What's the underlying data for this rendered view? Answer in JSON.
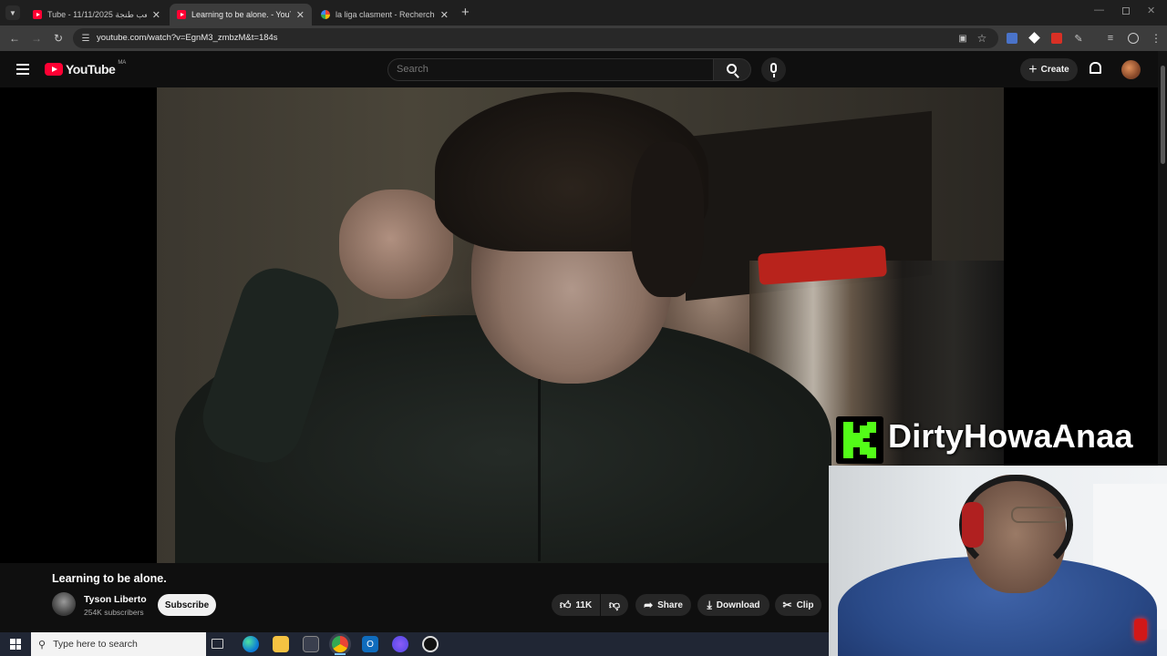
{
  "browser": {
    "tabs": [
      {
        "title": "Tube - 11/11/2025 ملعب طنجة",
        "active": false
      },
      {
        "title": "Learning to be alone. - YouTub",
        "active": true
      },
      {
        "title": "la liga clasment - Recherche Go",
        "active": false
      }
    ],
    "url": "youtube.com/watch?v=EgnM3_zmbzM&t=184s"
  },
  "youtube": {
    "logo_text": "YouTube",
    "region": "MA",
    "search_placeholder": "Search",
    "create_label": "Create"
  },
  "video": {
    "title": "Learning to be alone.",
    "channel": "Tyson Liberto",
    "subscribers": "254K subscribers",
    "subscribe_label": "Subscribe",
    "likes": "11K",
    "share_label": "Share",
    "download_label": "Download",
    "clip_label": "Clip"
  },
  "overlay": {
    "streamer_name": "DirtyHowaAnaa",
    "brand_letter": "K"
  },
  "taskbar": {
    "search_placeholder": "Type here to search"
  },
  "colors": {
    "youtube_red": "#ff0033",
    "kick_green": "#53fc18",
    "background": "#0f0f0f"
  }
}
